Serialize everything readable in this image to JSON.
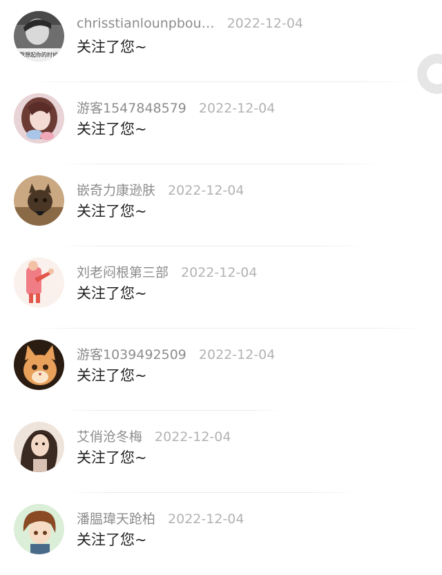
{
  "items": [
    {
      "username": "chrisstianlounpbou…",
      "date": "2022-12-04",
      "message": "关注了您~",
      "avatar": "avatar-boy-photo",
      "avatar_caption": "我想起你的时候"
    },
    {
      "username": "游客1547848579",
      "date": "2022-12-04",
      "message": "关注了您~",
      "avatar": "avatar-girl-photo"
    },
    {
      "username": "嵌奇力康逊肤",
      "date": "2022-12-04",
      "message": "关注了您~",
      "avatar": "avatar-kitten"
    },
    {
      "username": "刘老闷根第三部",
      "date": "2022-12-04",
      "message": "关注了您~",
      "avatar": "avatar-cartoon-pink"
    },
    {
      "username": "游客1039492509",
      "date": "2022-12-04",
      "message": "关注了您~",
      "avatar": "avatar-orange-cat"
    },
    {
      "username": "艾俏沧冬梅",
      "date": "2022-12-04",
      "message": "关注了您~",
      "avatar": "avatar-woman-photo"
    },
    {
      "username": "潘腽瑋天跄柏",
      "date": "2022-12-04",
      "message": "关注了您~",
      "avatar": "avatar-anime-boy"
    }
  ]
}
